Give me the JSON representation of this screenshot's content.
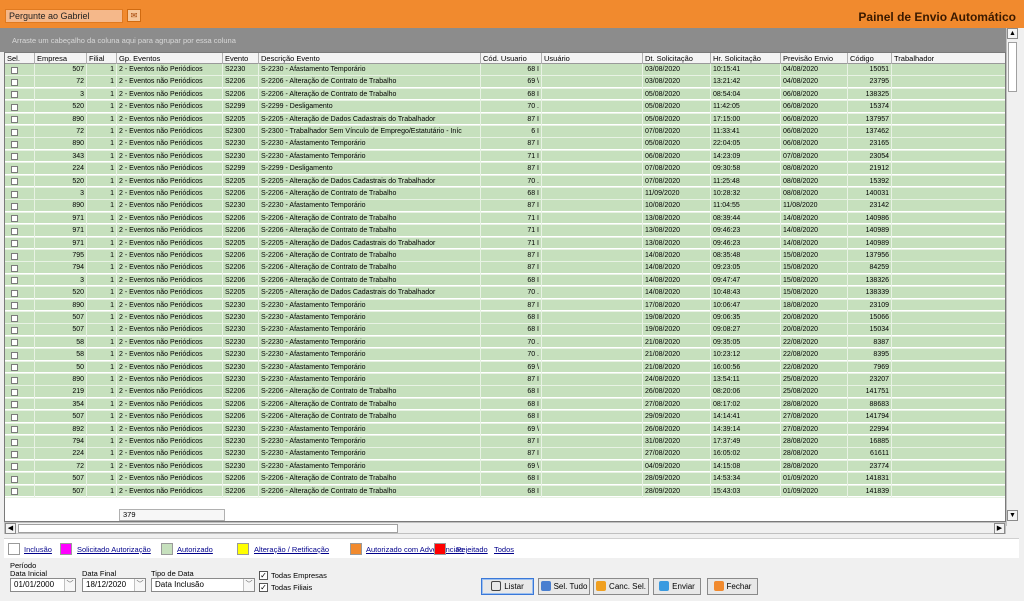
{
  "header": {
    "ask_placeholder": "Pergunte ao Gabriel",
    "ask_icon": "chat-icon",
    "title": "Painel de Envio Automático"
  },
  "group_hint": "Arraste um cabeçalho da coluna aqui para agrupar por essa coluna",
  "columns": [
    "Sel.",
    "Empresa",
    "Filial",
    "Gp. Eventos",
    "Evento",
    "Descrição Evento",
    "Cód. Usuario",
    "Usuário",
    "Dt. Solicitação",
    "Hr. Solicitação",
    "Previsão Envio",
    "Código",
    "Trabalhador"
  ],
  "rows": [
    {
      "empresa": "507",
      "filial": "1",
      "gp": "2 - Eventos não Periódicos",
      "evento": "S2230",
      "desc": "S-2230 - Afastamento Temporário",
      "cod": "68 I",
      "dt": "03/08/2020",
      "hr": "10:15:41",
      "prev": "04/08/2020",
      "codigo": "15051"
    },
    {
      "empresa": "72",
      "filial": "1",
      "gp": "2 - Eventos não Periódicos",
      "evento": "S2206",
      "desc": "S-2206 - Alteração de Contrato de Trabalho",
      "cod": "69 \\",
      "dt": "03/08/2020",
      "hr": "13:21:42",
      "prev": "04/08/2020",
      "codigo": "23795"
    },
    {
      "empresa": "3",
      "filial": "1",
      "gp": "2 - Eventos não Periódicos",
      "evento": "S2206",
      "desc": "S-2206 - Alteração de Contrato de Trabalho",
      "cod": "68 I",
      "dt": "05/08/2020",
      "hr": "08:54:04",
      "prev": "06/08/2020",
      "codigo": "138325"
    },
    {
      "empresa": "520",
      "filial": "1",
      "gp": "2 - Eventos não Periódicos",
      "evento": "S2299",
      "desc": "S-2299 - Desligamento",
      "cod": "70 .",
      "dt": "05/08/2020",
      "hr": "11:42:05",
      "prev": "06/08/2020",
      "codigo": "15374"
    },
    {
      "empresa": "890",
      "filial": "1",
      "gp": "2 - Eventos não Periódicos",
      "evento": "S2205",
      "desc": "S-2205 - Alteração de Dados Cadastrais do Trabalhador",
      "cod": "87 I",
      "dt": "05/08/2020",
      "hr": "17:15:00",
      "prev": "06/08/2020",
      "codigo": "137957"
    },
    {
      "empresa": "72",
      "filial": "1",
      "gp": "2 - Eventos não Periódicos",
      "evento": "S2300",
      "desc": "S-2300 - Trabalhador Sem Vínculo de Emprego/Estatutário - Iníc",
      "cod": "6 I",
      "dt": "07/08/2020",
      "hr": "11:33:41",
      "prev": "06/08/2020",
      "codigo": "137462"
    },
    {
      "empresa": "890",
      "filial": "1",
      "gp": "2 - Eventos não Periódicos",
      "evento": "S2230",
      "desc": "S-2230 - Afastamento Temporário",
      "cod": "87 I",
      "dt": "05/08/2020",
      "hr": "22:04:05",
      "prev": "06/08/2020",
      "codigo": "23165"
    },
    {
      "empresa": "343",
      "filial": "1",
      "gp": "2 - Eventos não Periódicos",
      "evento": "S2230",
      "desc": "S-2230 - Afastamento Temporário",
      "cod": "71 I",
      "dt": "06/08/2020",
      "hr": "14:23:09",
      "prev": "07/08/2020",
      "codigo": "23054"
    },
    {
      "empresa": "224",
      "filial": "1",
      "gp": "2 - Eventos não Periódicos",
      "evento": "S2299",
      "desc": "S-2299 - Desligamento",
      "cod": "87 I",
      "dt": "07/08/2020",
      "hr": "09:30:58",
      "prev": "08/08/2020",
      "codigo": "21912"
    },
    {
      "empresa": "520",
      "filial": "1",
      "gp": "2 - Eventos não Periódicos",
      "evento": "S2205",
      "desc": "S-2205 - Alteração de Dados Cadastrais do Trabalhador",
      "cod": "70 .",
      "dt": "07/08/2020",
      "hr": "11:25:48",
      "prev": "08/08/2020",
      "codigo": "15392"
    },
    {
      "empresa": "3",
      "filial": "1",
      "gp": "2 - Eventos não Periódicos",
      "evento": "S2206",
      "desc": "S-2206 - Alteração de Contrato de Trabalho",
      "cod": "68 I",
      "dt": "11/09/2020",
      "hr": "10:28:32",
      "prev": "08/08/2020",
      "codigo": "140031"
    },
    {
      "empresa": "890",
      "filial": "1",
      "gp": "2 - Eventos não Periódicos",
      "evento": "S2230",
      "desc": "S-2230 - Afastamento Temporário",
      "cod": "87 I",
      "dt": "10/08/2020",
      "hr": "11:04:55",
      "prev": "11/08/2020",
      "codigo": "23142"
    },
    {
      "empresa": "971",
      "filial": "1",
      "gp": "2 - Eventos não Periódicos",
      "evento": "S2206",
      "desc": "S-2206 - Alteração de Contrato de Trabalho",
      "cod": "71 I",
      "dt": "13/08/2020",
      "hr": "08:39:44",
      "prev": "14/08/2020",
      "codigo": "140986"
    },
    {
      "empresa": "971",
      "filial": "1",
      "gp": "2 - Eventos não Periódicos",
      "evento": "S2206",
      "desc": "S-2206 - Alteração de Contrato de Trabalho",
      "cod": "71 I",
      "dt": "13/08/2020",
      "hr": "09:46:23",
      "prev": "14/08/2020",
      "codigo": "140989"
    },
    {
      "empresa": "971",
      "filial": "1",
      "gp": "2 - Eventos não Periódicos",
      "evento": "S2205",
      "desc": "S-2205 - Alteração de Dados Cadastrais do Trabalhador",
      "cod": "71 I",
      "dt": "13/08/2020",
      "hr": "09:46:23",
      "prev": "14/08/2020",
      "codigo": "140989"
    },
    {
      "empresa": "795",
      "filial": "1",
      "gp": "2 - Eventos não Periódicos",
      "evento": "S2206",
      "desc": "S-2206 - Alteração de Contrato de Trabalho",
      "cod": "87 I",
      "dt": "14/08/2020",
      "hr": "08:35:48",
      "prev": "15/08/2020",
      "codigo": "137956"
    },
    {
      "empresa": "794",
      "filial": "1",
      "gp": "2 - Eventos não Periódicos",
      "evento": "S2206",
      "desc": "S-2206 - Alteração de Contrato de Trabalho",
      "cod": "87 I",
      "dt": "14/08/2020",
      "hr": "09:23:05",
      "prev": "15/08/2020",
      "codigo": "84259"
    },
    {
      "empresa": "3",
      "filial": "1",
      "gp": "2 - Eventos não Periódicos",
      "evento": "S2206",
      "desc": "S-2206 - Alteração de Contrato de Trabalho",
      "cod": "68 I",
      "dt": "14/08/2020",
      "hr": "09:47:47",
      "prev": "15/08/2020",
      "codigo": "138326"
    },
    {
      "empresa": "520",
      "filial": "1",
      "gp": "2 - Eventos não Periódicos",
      "evento": "S2205",
      "desc": "S-2205 - Alteração de Dados Cadastrais do Trabalhador",
      "cod": "70 .",
      "dt": "14/08/2020",
      "hr": "10:48:43",
      "prev": "15/08/2020",
      "codigo": "138339"
    },
    {
      "empresa": "890",
      "filial": "1",
      "gp": "2 - Eventos não Periódicos",
      "evento": "S2230",
      "desc": "S-2230 - Afastamento Temporário",
      "cod": "87 I",
      "dt": "17/08/2020",
      "hr": "10:06:47",
      "prev": "18/08/2020",
      "codigo": "23109"
    },
    {
      "empresa": "507",
      "filial": "1",
      "gp": "2 - Eventos não Periódicos",
      "evento": "S2230",
      "desc": "S-2230 - Afastamento Temporário",
      "cod": "68 I",
      "dt": "19/08/2020",
      "hr": "09:06:35",
      "prev": "20/08/2020",
      "codigo": "15066"
    },
    {
      "empresa": "507",
      "filial": "1",
      "gp": "2 - Eventos não Periódicos",
      "evento": "S2230",
      "desc": "S-2230 - Afastamento Temporário",
      "cod": "68 I",
      "dt": "19/08/2020",
      "hr": "09:08:27",
      "prev": "20/08/2020",
      "codigo": "15034"
    },
    {
      "empresa": "58",
      "filial": "1",
      "gp": "2 - Eventos não Periódicos",
      "evento": "S2230",
      "desc": "S-2230 - Afastamento Temporário",
      "cod": "70 .",
      "dt": "21/08/2020",
      "hr": "09:35:05",
      "prev": "22/08/2020",
      "codigo": "8387"
    },
    {
      "empresa": "58",
      "filial": "1",
      "gp": "2 - Eventos não Periódicos",
      "evento": "S2230",
      "desc": "S-2230 - Afastamento Temporário",
      "cod": "70 .",
      "dt": "21/08/2020",
      "hr": "10:23:12",
      "prev": "22/08/2020",
      "codigo": "8395"
    },
    {
      "empresa": "50",
      "filial": "1",
      "gp": "2 - Eventos não Periódicos",
      "evento": "S2230",
      "desc": "S-2230 - Afastamento Temporário",
      "cod": "69 \\",
      "dt": "21/08/2020",
      "hr": "16:00:56",
      "prev": "22/08/2020",
      "codigo": "7969"
    },
    {
      "empresa": "890",
      "filial": "1",
      "gp": "2 - Eventos não Periódicos",
      "evento": "S2230",
      "desc": "S-2230 - Afastamento Temporário",
      "cod": "87 I",
      "dt": "24/08/2020",
      "hr": "13:54:11",
      "prev": "25/08/2020",
      "codigo": "23207"
    },
    {
      "empresa": "219",
      "filial": "1",
      "gp": "2 - Eventos não Periódicos",
      "evento": "S2206",
      "desc": "S-2206 - Alteração de Contrato de Trabalho",
      "cod": "68 I",
      "dt": "26/08/2020",
      "hr": "08:20:06",
      "prev": "25/08/2020",
      "codigo": "141751"
    },
    {
      "empresa": "354",
      "filial": "1",
      "gp": "2 - Eventos não Periódicos",
      "evento": "S2206",
      "desc": "S-2206 - Alteração de Contrato de Trabalho",
      "cod": "68 I",
      "dt": "27/08/2020",
      "hr": "08:17:02",
      "prev": "28/08/2020",
      "codigo": "88683"
    },
    {
      "empresa": "507",
      "filial": "1",
      "gp": "2 - Eventos não Periódicos",
      "evento": "S2206",
      "desc": "S-2206 - Alteração de Contrato de Trabalho",
      "cod": "68 I",
      "dt": "29/09/2020",
      "hr": "14:14:41",
      "prev": "27/08/2020",
      "codigo": "141794"
    },
    {
      "empresa": "892",
      "filial": "1",
      "gp": "2 - Eventos não Periódicos",
      "evento": "S2230",
      "desc": "S-2230 - Afastamento Temporário",
      "cod": "69 \\",
      "dt": "26/08/2020",
      "hr": "14:39:14",
      "prev": "27/08/2020",
      "codigo": "22994"
    },
    {
      "empresa": "794",
      "filial": "1",
      "gp": "2 - Eventos não Periódicos",
      "evento": "S2230",
      "desc": "S-2230 - Afastamento Temporário",
      "cod": "87 I",
      "dt": "31/08/2020",
      "hr": "17:37:49",
      "prev": "28/08/2020",
      "codigo": "16885"
    },
    {
      "empresa": "224",
      "filial": "1",
      "gp": "2 - Eventos não Periódicos",
      "evento": "S2230",
      "desc": "S-2230 - Afastamento Temporário",
      "cod": "87 I",
      "dt": "27/08/2020",
      "hr": "16:05:02",
      "prev": "28/08/2020",
      "codigo": "61611"
    },
    {
      "empresa": "72",
      "filial": "1",
      "gp": "2 - Eventos não Periódicos",
      "evento": "S2230",
      "desc": "S-2230 - Afastamento Temporário",
      "cod": "69 \\",
      "dt": "04/09/2020",
      "hr": "14:15:08",
      "prev": "28/08/2020",
      "codigo": "23774"
    },
    {
      "empresa": "507",
      "filial": "1",
      "gp": "2 - Eventos não Periódicos",
      "evento": "S2206",
      "desc": "S-2206 - Alteração de Contrato de Trabalho",
      "cod": "68 I",
      "dt": "28/09/2020",
      "hr": "14:53:34",
      "prev": "01/09/2020",
      "codigo": "141831"
    },
    {
      "empresa": "507",
      "filial": "1",
      "gp": "2 - Eventos não Periódicos",
      "evento": "S2206",
      "desc": "S-2206 - Alteração de Contrato de Trabalho",
      "cod": "68 I",
      "dt": "28/09/2020",
      "hr": "15:43:03",
      "prev": "01/09/2020",
      "codigo": "141839"
    }
  ],
  "record_count": "379",
  "legend": [
    {
      "label": "Inclusão",
      "color": "#ffffff"
    },
    {
      "label": "Solicitado Autorização",
      "color": "#ff00ff"
    },
    {
      "label": "Autorizado",
      "color": "#c6e0bd"
    },
    {
      "label": "Alteração / Retificação",
      "color": "#ffff00"
    },
    {
      "label": "Autorizado com Advertencias",
      "color": "#f18a2e"
    },
    {
      "label": "Rejeitado",
      "color": "#ff0000"
    },
    {
      "label": "Todos",
      "color": ""
    }
  ],
  "filters": {
    "periodo_label": "Período",
    "data_inicial_label": "Data Inicial",
    "data_inicial": "01/01/2000",
    "data_final_label": "Data Final",
    "data_final": "18/12/2020",
    "tipo_data_label": "Tipo de Data",
    "tipo_data": "Data Inclusão",
    "todas_empresas": "Todas Empresas",
    "todas_filiais": "Todas Filiais"
  },
  "buttons": {
    "listar": "Listar",
    "sel_tudo": "Sel. Tudo",
    "canc_sel": "Canc. Sel.",
    "enviar": "Enviar",
    "fechar": "Fechar"
  }
}
